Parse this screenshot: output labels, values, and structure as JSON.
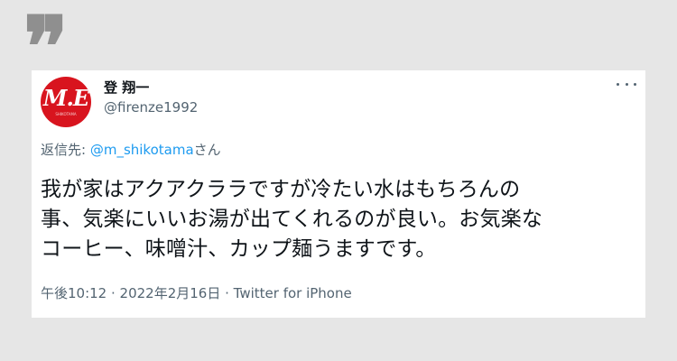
{
  "quote_mark": "❞",
  "tweet": {
    "avatar_text": "M.E",
    "avatar_sub": "SHIKOTAMA",
    "display_name": "登 翔一",
    "handle": "@firenze1992",
    "reply_prefix": "返信先: ",
    "reply_user": "@m_shikotama",
    "reply_suffix": "さん",
    "body_lines": [
      "我が家はアクアクララですが冷たい水はもちろんの",
      "事、気楽にいいお湯が出てくれるのが良い。お気楽な",
      "コーヒー、味噌汁、カップ麺うますです。"
    ],
    "timestamp": "午後10:12 · 2022年2月16日",
    "separator": " · ",
    "source": "Twitter for iPhone"
  },
  "colors": {
    "background": "#e6e6e6",
    "card": "#ffffff",
    "link": "#1d9bf0",
    "secondary_text": "#536471",
    "avatar": "#d8141e"
  },
  "icons": {
    "quote": "quote-icon",
    "more": "more-icon"
  }
}
